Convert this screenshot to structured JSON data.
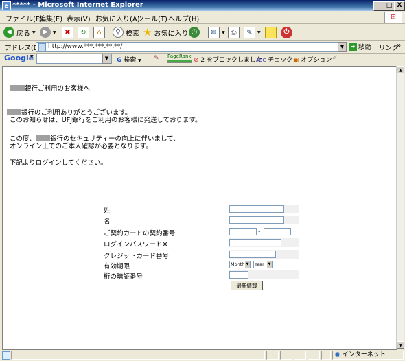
{
  "window": {
    "title": "***** - Microsoft Internet Explorer",
    "min": "_",
    "max": "□",
    "close": "X"
  },
  "menu": [
    "ファイル(F)",
    "編集(E)",
    "表示(V)",
    "お気に入り(A)",
    "ツール(T)",
    "ヘルプ(H)"
  ],
  "toolbar": {
    "back": "戻る",
    "search": "検索",
    "favorites": "お気に入り"
  },
  "address": {
    "label": "アドレス(D)",
    "url": "http://www.***.***.**.**/",
    "go": "移動",
    "links": "リンク",
    "more": "»"
  },
  "google": {
    "brand": "Google",
    "search": "検索",
    "pagerank": "PageRank",
    "blocked": "2 をブロックしました",
    "check": "チェック",
    "options": "オプション"
  },
  "content": {
    "greeting": "銀行ご利用のお客様へ",
    "p1_line1": "銀行のご利用ありがとうございます。",
    "p1_line2": "このお知らせは、UFJ銀行をご利用のお客様に発送しております。",
    "p2_line1_pre": "この度、",
    "p2_line1_post": "銀行のセキュリティーの向上に伴いまして、",
    "p2_line2": "オンライン上でのご本人確認が必要となります。",
    "p3": "下記よりログインしてください。"
  },
  "form": {
    "labels": [
      "姓",
      "名",
      "ご契約カードの契約番号",
      "ログインパスワード※",
      "クレジットカード番号",
      "有効期限",
      "桁の暗証番号"
    ],
    "dash": "-",
    "month": "Month",
    "year": "Year",
    "submit": "最新情報"
  },
  "status": {
    "zone": "インターネット"
  }
}
